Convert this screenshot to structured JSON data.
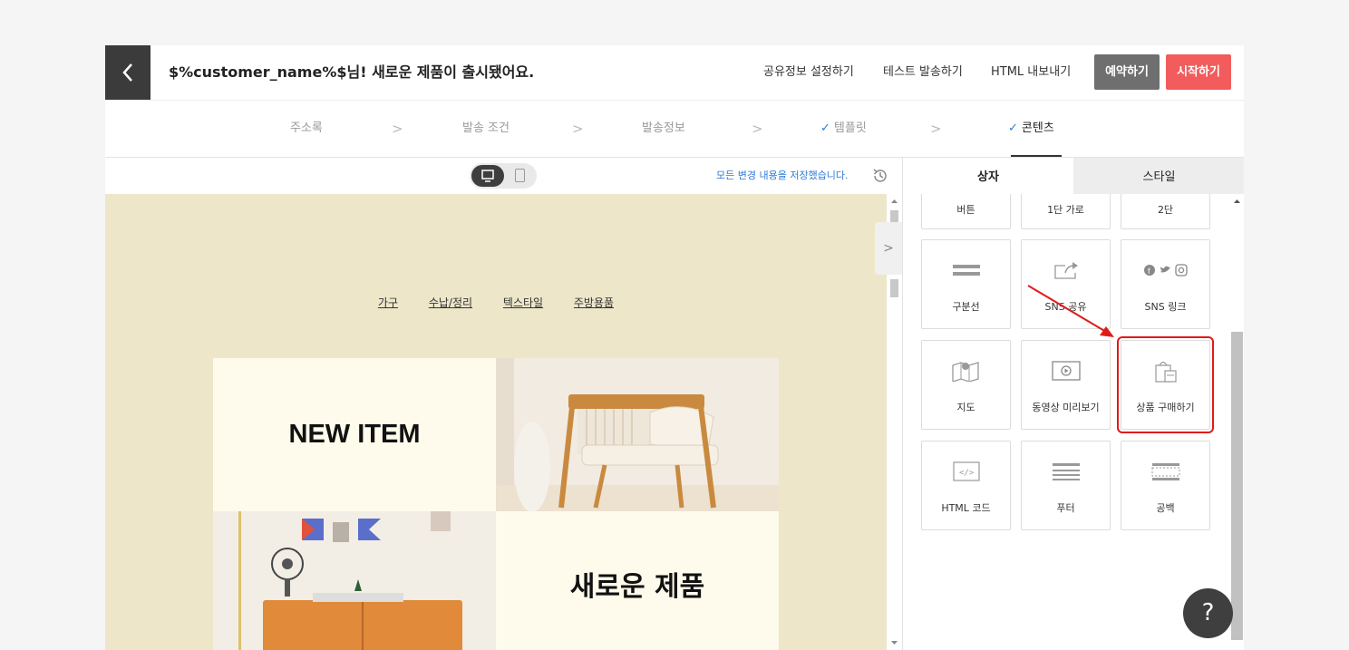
{
  "header": {
    "title": "$%customer_name%$님! 새로운 제품이 출시됐어요.",
    "links": [
      "공유정보 설정하기",
      "테스트 발송하기",
      "HTML 내보내기"
    ],
    "reserve_label": "예약하기",
    "start_label": "시작하기"
  },
  "steps": [
    {
      "label": "주소록",
      "done": false
    },
    {
      "label": "발송 조건",
      "done": false
    },
    {
      "label": "발송정보",
      "done": false
    },
    {
      "label": "템플릿",
      "done": true
    },
    {
      "label": "콘텐츠",
      "done": true
    }
  ],
  "editor": {
    "save_status": "모든 변경 내용을 저장했습니다.",
    "preview": {
      "nav": [
        "가구",
        "수납/정리",
        "텍스타일",
        "주방용품"
      ],
      "tile1_text": "NEW ITEM",
      "tile2_text": "새로운 제품"
    }
  },
  "panel": {
    "tabs": [
      "상자",
      "스타일"
    ],
    "blocks": [
      {
        "label": "버튼",
        "icon": "button-icon"
      },
      {
        "label": "1단 가로",
        "icon": "one-column-icon"
      },
      {
        "label": "2단",
        "icon": "two-column-icon"
      },
      {
        "label": "구분선",
        "icon": "divider-icon"
      },
      {
        "label": "SNS 공유",
        "icon": "share-icon"
      },
      {
        "label": "SNS 링크",
        "icon": "sns-links-icon"
      },
      {
        "label": "지도",
        "icon": "map-icon"
      },
      {
        "label": "동영상 미리보기",
        "icon": "video-icon"
      },
      {
        "label": "상품 구매하기",
        "icon": "product-purchase-icon"
      },
      {
        "label": "HTML 코드",
        "icon": "html-code-icon"
      },
      {
        "label": "푸터",
        "icon": "footer-icon"
      },
      {
        "label": "공백",
        "icon": "spacer-icon"
      }
    ]
  },
  "help_label": "?",
  "colors": {
    "header_back": "#3b3b3b",
    "reserve_button": "#6f6f6f",
    "start_button": "#f25c5c",
    "link_blue": "#2f7ad6",
    "canvas_bg": "#ede6c9",
    "tile_bg": "#fefbec",
    "highlight": "#e11a1a"
  }
}
